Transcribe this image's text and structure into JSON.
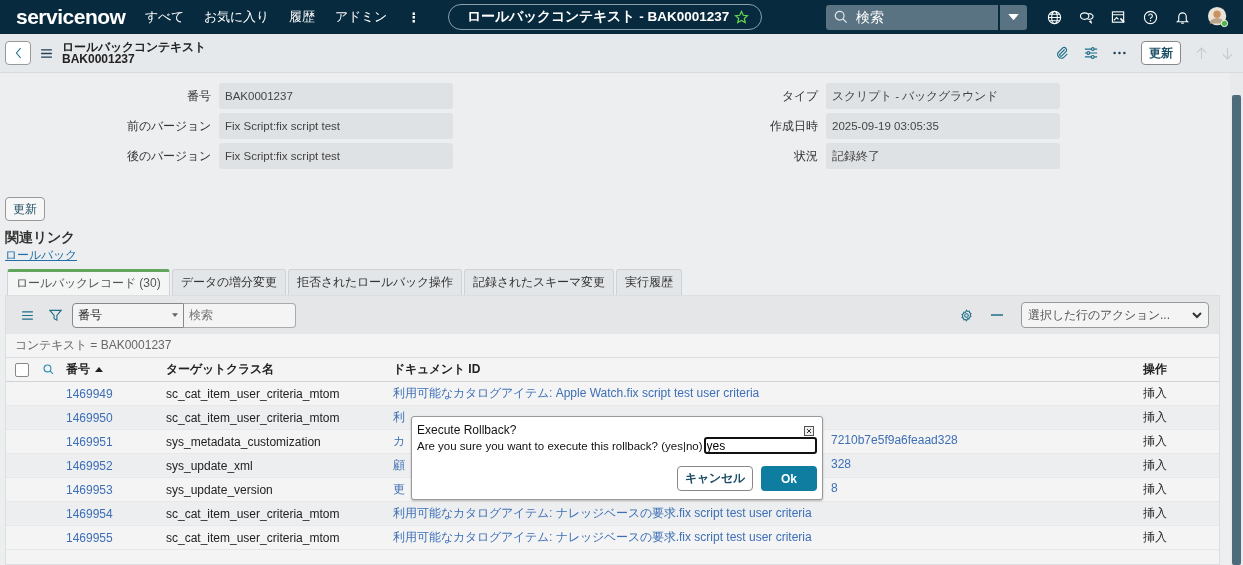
{
  "top_nav": {
    "logo": "servicenow",
    "menu": [
      "すべて",
      "お気に入り",
      "履歴",
      "アドミン"
    ],
    "more": "⋮",
    "context_title": "ロールバックコンテキスト - BAK0001237",
    "favorite": false,
    "search_placeholder": "検索"
  },
  "header": {
    "title": "ロールバックコンテキスト",
    "subtitle": "BAK0001237",
    "update_button": "更新",
    "prev_disabled": true,
    "next_disabled": true
  },
  "form": {
    "left": [
      {
        "label": "番号",
        "value": "BAK0001237"
      },
      {
        "label": "前のバージョン",
        "value": "Fix Script:fix script test"
      },
      {
        "label": "後のバージョン",
        "value": "Fix Script:fix script test"
      }
    ],
    "right": [
      {
        "label": "タイプ",
        "value": "スクリプト - バックグラウンド"
      },
      {
        "label": "作成日時",
        "value": "2025-09-19 03:05:35"
      },
      {
        "label": "状況",
        "value": "記録終了"
      }
    ]
  },
  "update_button": "更新",
  "related_links": {
    "title": "関連リンク",
    "links": [
      "ロールバック"
    ]
  },
  "tabs": [
    {
      "label": "ロールバックレコード (30)",
      "selected": true
    },
    {
      "label": "データの増分変更",
      "selected": false
    },
    {
      "label": "拒否されたロールバック操作",
      "selected": false
    },
    {
      "label": "記録されたスキーマ変更",
      "selected": false
    },
    {
      "label": "実行履歴",
      "selected": false
    }
  ],
  "list": {
    "field_select": "番号",
    "search_placeholder": "検索",
    "actions_select": "選択した行のアクション...",
    "breadcrumb": "コンテキスト = BAK0001237",
    "select_all_checked": false,
    "columns": [
      "番号",
      "ターゲットクラス名",
      "ドキュメント ID",
      "操作"
    ],
    "rows": [
      {
        "number": "1469949",
        "class": "sc_cat_item_user_criteria_mtom",
        "doc_start": "利用可能なカタログアイテム: Apple Watch.fix script test user criteria",
        "operation": "挿入"
      },
      {
        "number": "1469950",
        "class": "sc_cat_item_user_criteria_mtom",
        "doc_start": "利",
        "operation": "挿入"
      },
      {
        "number": "1469951",
        "class": "sys_metadata_customization",
        "doc_start": "カ",
        "doc_end": "7210b7e5f9a6feaad328",
        "operation": "挿入"
      },
      {
        "number": "1469952",
        "class": "sys_update_xml",
        "doc_start": "顧",
        "doc_end": "328",
        "operation": "挿入"
      },
      {
        "number": "1469953",
        "class": "sys_update_version",
        "doc_start": "更",
        "doc_end": "8",
        "operation": "挿入"
      },
      {
        "number": "1469954",
        "class": "sc_cat_item_user_criteria_mtom",
        "doc_start": "利用可能なカタログアイテム: ナレッジベースの要求.fix script test user criteria",
        "operation": "挿入"
      },
      {
        "number": "1469955",
        "class": "sc_cat_item_user_criteria_mtom",
        "doc_start": "利用可能なカタログアイテム: ナレッジベースの要求.fix script test user criteria",
        "operation": "挿入"
      }
    ]
  },
  "dialog": {
    "title": "Execute Rollback?",
    "message": "Are you sure you want to execute this rollback? (yes|no)",
    "value": "yes",
    "cancel": "キャンセル",
    "ok": "Ok"
  }
}
